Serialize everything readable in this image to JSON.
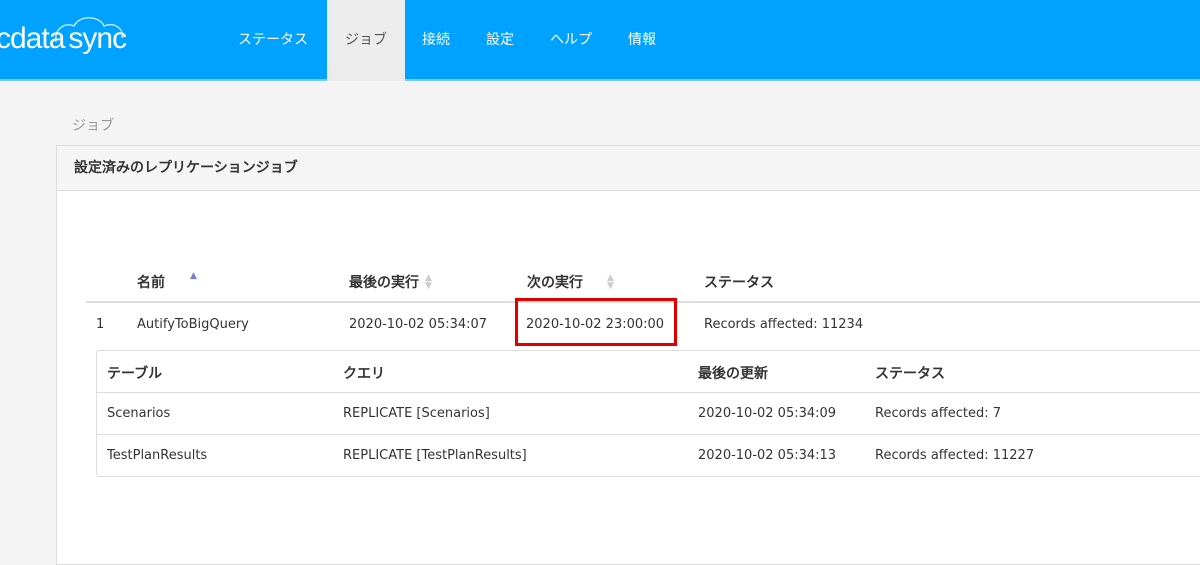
{
  "app": {
    "logo_cdata": "cdata",
    "logo_sync": "sync"
  },
  "nav": [
    {
      "label": "ステータス"
    },
    {
      "label": "ジョブ",
      "active": true
    },
    {
      "label": "接続"
    },
    {
      "label": "設定"
    },
    {
      "label": "ヘルプ"
    },
    {
      "label": "情報"
    }
  ],
  "breadcrumb": "ジョブ",
  "panel": {
    "title": "設定済みのレプリケーションジョブ"
  },
  "jobs": {
    "columns": [
      "名前",
      "最後の実行",
      "次の実行",
      "ステータス"
    ],
    "rows": [
      {
        "index": "1",
        "name": "AutifyToBigQuery",
        "last_run": "2020-10-02 05:34:07",
        "next_run": "2020-10-02 23:00:00",
        "status": "Records affected: 11234"
      }
    ]
  },
  "tables": {
    "columns": [
      "テーブル",
      "クエリ",
      "最後の更新",
      "ステータス"
    ],
    "rows": [
      {
        "table": "Scenarios",
        "query": "REPLICATE [Scenarios]",
        "updated": "2020-10-02 05:34:09",
        "status": "Records affected: 7"
      },
      {
        "table": "TestPlanResults",
        "query": "REPLICATE [TestPlanResults]",
        "updated": "2020-10-02 05:34:13",
        "status": "Records affected: 11227"
      }
    ]
  },
  "colors": {
    "nav": "#00a2ff",
    "highlight": "#e00000",
    "sort_active": "#7b7bd1"
  }
}
